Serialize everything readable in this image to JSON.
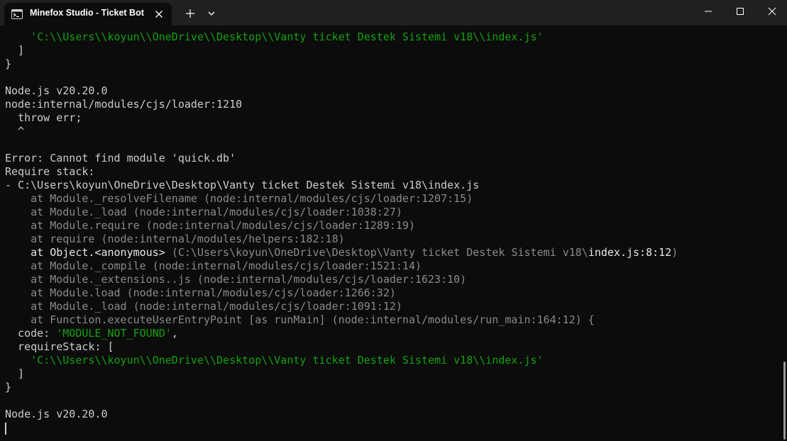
{
  "window": {
    "tab_title": "Minefox Studio - Ticket Bot",
    "icons": {
      "tab": "terminal-icon",
      "tab_close": "close-icon",
      "new_tab": "plus-icon",
      "dropdown": "chevron-down-icon",
      "minimize": "minimize-icon",
      "maximize": "maximize-icon",
      "close": "close-icon"
    }
  },
  "colors": {
    "background": "#0c0c0c",
    "titlebar": "#202020",
    "text": "#cccccc",
    "string": "#13a10e",
    "dim": "#8a8a8a"
  },
  "terminal": {
    "lines": [
      [
        {
          "t": "    ",
          "c": "default"
        },
        {
          "t": "'C:\\\\Users\\\\koyun\\\\OneDrive\\\\Desktop\\\\Vanty ticket Destek Sistemi v18\\\\index.js'",
          "c": "green"
        }
      ],
      [
        {
          "t": "  ]",
          "c": "default"
        }
      ],
      [
        {
          "t": "}",
          "c": "default"
        }
      ],
      [],
      [
        {
          "t": "Node.js v20.20.0",
          "c": "default"
        }
      ],
      [
        {
          "t": "node:internal/modules/cjs/loader:1210",
          "c": "default"
        }
      ],
      [
        {
          "t": "  throw err;",
          "c": "default"
        }
      ],
      [
        {
          "t": "  ^",
          "c": "default"
        }
      ],
      [],
      [
        {
          "t": "Error: Cannot find module 'quick.db'",
          "c": "default"
        }
      ],
      [
        {
          "t": "Require stack:",
          "c": "default"
        }
      ],
      [
        {
          "t": "- C:\\Users\\koyun\\OneDrive\\Desktop\\Vanty ticket Destek Sistemi v18\\index.js",
          "c": "default"
        }
      ],
      [
        {
          "t": "    at Module._resolveFilename (node:internal/modules/cjs/loader:1207:15)",
          "c": "gray"
        }
      ],
      [
        {
          "t": "    at Module._load (node:internal/modules/cjs/loader:1038:27)",
          "c": "gray"
        }
      ],
      [
        {
          "t": "    at Module.require (node:internal/modules/cjs/loader:1289:19)",
          "c": "gray"
        }
      ],
      [
        {
          "t": "    at require (node:internal/modules/helpers:182:18)",
          "c": "gray"
        }
      ],
      [
        {
          "t": "    at Object.<anonymous> ",
          "c": "white"
        },
        {
          "t": "(C:\\Users\\koyun\\OneDrive\\Desktop\\Vanty ticket Destek Sistemi v18\\",
          "c": "gray"
        },
        {
          "t": "index.js:8:12",
          "c": "white"
        },
        {
          "t": ")",
          "c": "gray"
        }
      ],
      [
        {
          "t": "    at Module._compile (node:internal/modules/cjs/loader:1521:14)",
          "c": "gray"
        }
      ],
      [
        {
          "t": "    at Module._extensions..js (node:internal/modules/cjs/loader:1623:10)",
          "c": "gray"
        }
      ],
      [
        {
          "t": "    at Module.load (node:internal/modules/cjs/loader:1266:32)",
          "c": "gray"
        }
      ],
      [
        {
          "t": "    at Module._load (node:internal/modules/cjs/loader:1091:12)",
          "c": "gray"
        }
      ],
      [
        {
          "t": "    at Function.executeUserEntryPoint [as runMain] (node:internal/modules/run_main:164:12) {",
          "c": "gray"
        }
      ],
      [
        {
          "t": "  code: ",
          "c": "default"
        },
        {
          "t": "'MODULE_NOT_FOUND'",
          "c": "green"
        },
        {
          "t": ",",
          "c": "default"
        }
      ],
      [
        {
          "t": "  requireStack: [",
          "c": "default"
        }
      ],
      [
        {
          "t": "    ",
          "c": "default"
        },
        {
          "t": "'C:\\\\Users\\\\koyun\\\\OneDrive\\\\Desktop\\\\Vanty ticket Destek Sistemi v18\\\\index.js'",
          "c": "green"
        }
      ],
      [
        {
          "t": "  ]",
          "c": "default"
        }
      ],
      [
        {
          "t": "}",
          "c": "default"
        }
      ],
      [],
      [
        {
          "t": "Node.js v20.20.0",
          "c": "default"
        }
      ]
    ]
  }
}
